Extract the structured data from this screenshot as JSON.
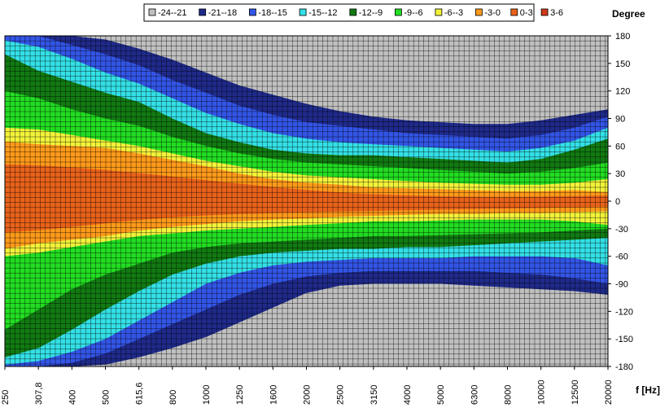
{
  "chart_data": {
    "type": "heatmap",
    "subtype": "polar directivity contour map",
    "x_axis": {
      "label": "f [Hz]",
      "scale": "log",
      "range": [
        250,
        20000
      ],
      "ticks": [
        "250",
        "307,8",
        "400",
        "500",
        "615,6",
        "800",
        "1000",
        "1250",
        "1600",
        "2000",
        "2500",
        "3150",
        "4000",
        "5000",
        "6300",
        "8000",
        "10000",
        "12500",
        "20000"
      ]
    },
    "y_axis": {
      "label": "Degree",
      "range": [
        -180,
        180
      ],
      "ticks": [
        180,
        150,
        120,
        90,
        60,
        30,
        0,
        -30,
        -60,
        -90,
        -120,
        -150,
        -180
      ]
    },
    "legend": {
      "placement": "top",
      "entries": [
        {
          "label": "-24--21",
          "color": "#c0c0c0"
        },
        {
          "label": "-21--18",
          "color": "#1f2a8a"
        },
        {
          "label": "-18--15",
          "color": "#3355e6"
        },
        {
          "label": "-15--12",
          "color": "#33e0e6"
        },
        {
          "label": "-12--9",
          "color": "#127a12"
        },
        {
          "label": "-9--6",
          "color": "#22dd22"
        },
        {
          "label": "-6--3",
          "color": "#f2f23a"
        },
        {
          "label": "-3-0",
          "color": "#ff9a1a"
        },
        {
          "label": "0-3",
          "color": "#e8621a"
        },
        {
          "label": "3-6",
          "color": "#cc3a1a"
        }
      ]
    },
    "grid": true,
    "contour_bands": [
      {
        "level": "-3-0",
        "upper": [
          65,
          62,
          60,
          58,
          52,
          45,
          38,
          30,
          24,
          20,
          18,
          15,
          14,
          13,
          12,
          11,
          11,
          12,
          10
        ],
        "lower": [
          -52,
          -46,
          -42,
          -38,
          -32,
          -28,
          -25,
          -22,
          -20,
          -19,
          -17,
          -16,
          -15,
          -14,
          -14,
          -13,
          -13,
          -12,
          -11
        ]
      },
      {
        "level": "-6--3",
        "upper": [
          80,
          78,
          72,
          66,
          60,
          52,
          44,
          38,
          32,
          28,
          26,
          24,
          22,
          20,
          19,
          18,
          18,
          20,
          24
        ],
        "lower": [
          -60,
          -56,
          -50,
          -44,
          -38,
          -35,
          -32,
          -30,
          -28,
          -26,
          -24,
          -22,
          -22,
          -21,
          -20,
          -20,
          -20,
          -22,
          -26
        ]
      },
      {
        "level": "-9--6",
        "upper": [
          120,
          112,
          100,
          90,
          82,
          70,
          60,
          52,
          46,
          42,
          40,
          38,
          36,
          34,
          32,
          30,
          32,
          36,
          42
        ],
        "lower": [
          -140,
          -118,
          -96,
          -80,
          -68,
          -56,
          -50,
          -46,
          -44,
          -42,
          -40,
          -38,
          -38,
          -37,
          -36,
          -35,
          -34,
          -32,
          -30
        ]
      },
      {
        "level": "-12--9",
        "upper": [
          160,
          142,
          130,
          118,
          108,
          90,
          74,
          64,
          56,
          52,
          50,
          50,
          48,
          46,
          44,
          42,
          46,
          56,
          68
        ],
        "lower": [
          -170,
          -160,
          -140,
          -118,
          -98,
          -80,
          -68,
          -60,
          -56,
          -54,
          -52,
          -52,
          -50,
          -50,
          -48,
          -46,
          -44,
          -42,
          -40
        ]
      },
      {
        "level": "-15--12",
        "upper": [
          175,
          168,
          155,
          140,
          128,
          112,
          96,
          84,
          74,
          68,
          64,
          62,
          60,
          58,
          56,
          54,
          58,
          66,
          80
        ],
        "lower": [
          -178,
          -174,
          -164,
          -150,
          -130,
          -110,
          -90,
          -78,
          -70,
          -66,
          -64,
          -62,
          -62,
          -62,
          -60,
          -60,
          -60,
          -62,
          -70
        ]
      },
      {
        "level": "-18--15",
        "upper": [
          180,
          180,
          170,
          160,
          148,
          132,
          118,
          104,
          94,
          86,
          82,
          78,
          74,
          72,
          70,
          68,
          72,
          80,
          92
        ],
        "lower": [
          -180,
          -180,
          -176,
          -166,
          -150,
          -134,
          -118,
          -102,
          -90,
          -82,
          -78,
          -76,
          -76,
          -76,
          -76,
          -78,
          -80,
          -84,
          -90
        ]
      },
      {
        "level": "-21--18",
        "upper": [
          180,
          180,
          180,
          176,
          166,
          154,
          140,
          126,
          116,
          106,
          98,
          92,
          88,
          86,
          84,
          84,
          88,
          94,
          100
        ],
        "lower": [
          -180,
          -180,
          -180,
          -178,
          -170,
          -160,
          -148,
          -132,
          -116,
          -100,
          -92,
          -90,
          -90,
          -90,
          -92,
          -94,
          -96,
          -98,
          -102
        ]
      }
    ]
  }
}
